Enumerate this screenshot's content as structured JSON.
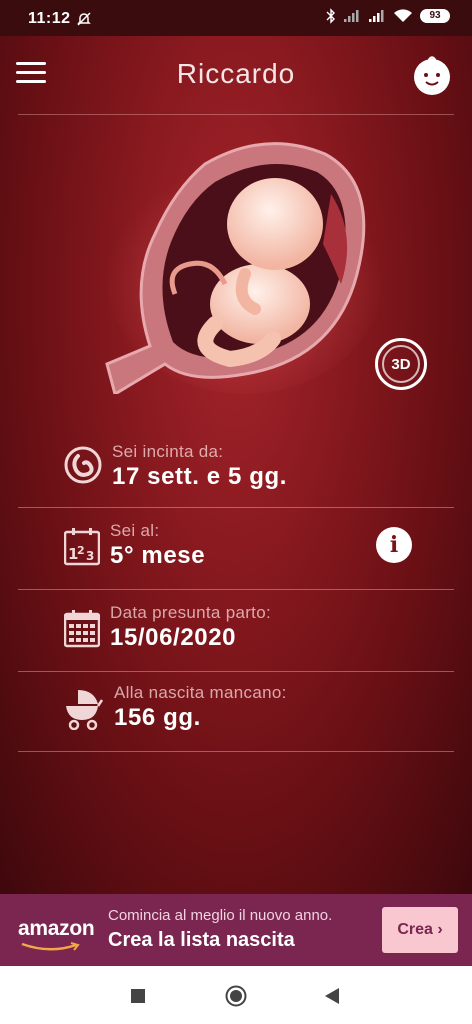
{
  "status_bar": {
    "time": "11:12",
    "battery": "93"
  },
  "header": {
    "title": "Riccardo",
    "menu_icon": "hamburger-menu-icon",
    "profile_icon": "baby-face-icon"
  },
  "illustration": {
    "button_3d": "3D"
  },
  "info": [
    {
      "label": "Sei incinta da:",
      "value": "17 sett. e 5 gg.",
      "icon": "pregnancy-icon"
    },
    {
      "label": "Sei al:",
      "value": "5° mese",
      "icon": "numbers-123-icon"
    },
    {
      "label": "Data presunta parto:",
      "value": "15/06/2020",
      "icon": "calendar-icon"
    },
    {
      "label": "Alla nascita mancano:",
      "value": "156 gg.",
      "icon": "stroller-icon"
    }
  ],
  "info_button": "i",
  "ad": {
    "logo": "amazon",
    "line1": "Comincia al meglio il nuovo anno.",
    "line2": "Crea la lista nascita",
    "cta": "Crea ›"
  },
  "colors": {
    "background_center": "#a5242b",
    "background_edge": "#3e080c",
    "status_bar": "#3a0c0e",
    "ad_background": "#7a2650",
    "ad_button": "#f9c7cf"
  }
}
